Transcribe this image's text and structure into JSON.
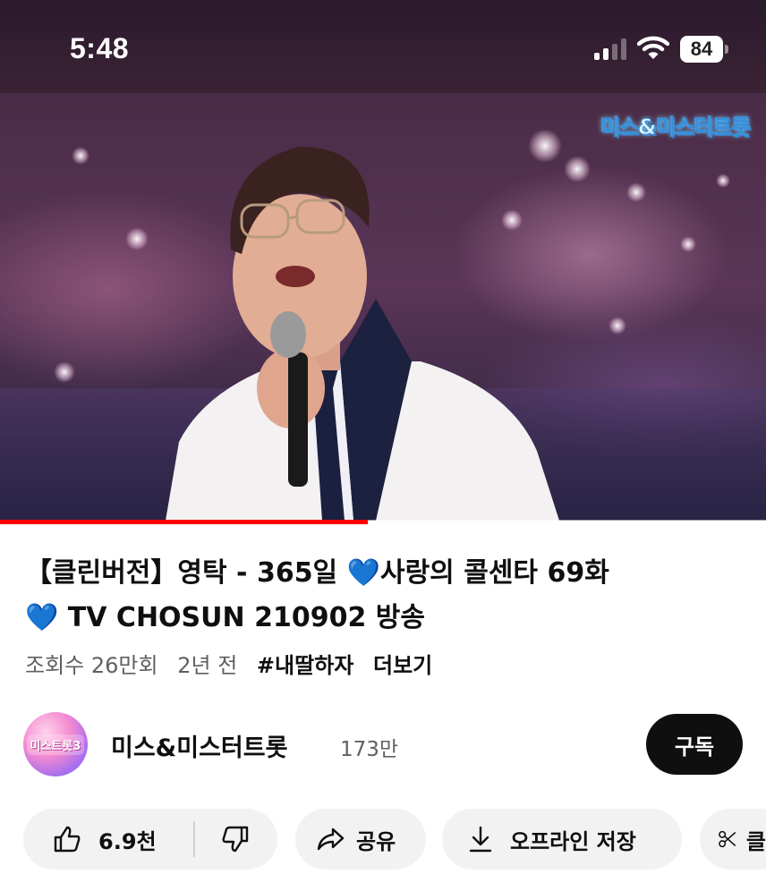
{
  "status_bar": {
    "time": "5:48",
    "battery": "84",
    "signal_icon": "cellular-signal-icon",
    "wifi_icon": "wifi-icon"
  },
  "video": {
    "show_logo": "미스&미스터트롯",
    "progress": 0.48,
    "accent_color": "#ff0000"
  },
  "title": {
    "part1": "【클린버전】영탁 - 365일 ",
    "heart1": "💙",
    "part2": "사랑의 콜센타 69화",
    "heart2": "💙",
    "part3": " TV CHOSUN 210902 방송"
  },
  "meta": {
    "views": "조회수 26만회",
    "age": "2년 전",
    "hashtag": "#내딸하자",
    "more": "더보기"
  },
  "channel": {
    "avatar_text": "미스트롯3",
    "name": "미스&미스터트롯",
    "subscribers": "173만",
    "subscribe_label": "구독"
  },
  "actions": {
    "like_count": "6.9천",
    "share_label": "공유",
    "download_label": "오프라인 저장",
    "clip_label": "클"
  }
}
